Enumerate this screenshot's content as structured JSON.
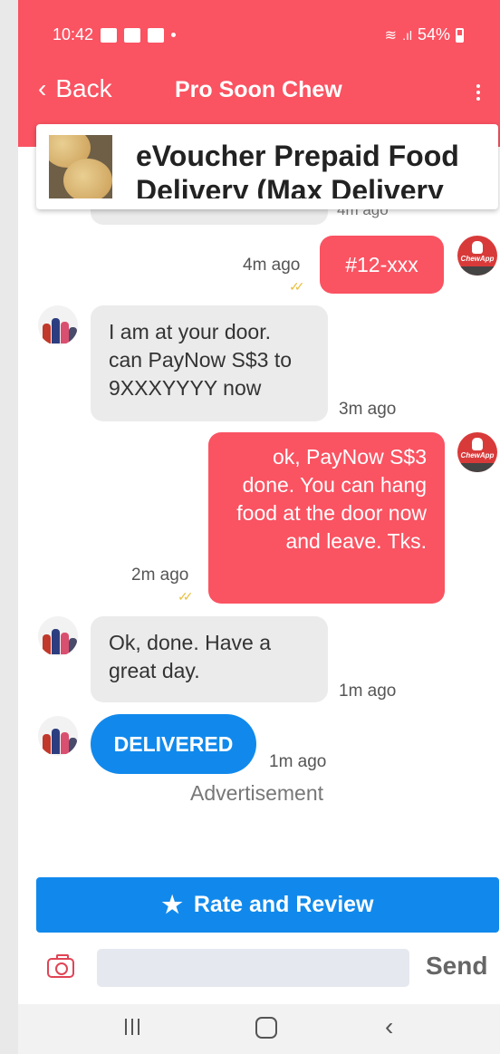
{
  "status": {
    "time": "10:42",
    "battery": "54%"
  },
  "header": {
    "back_label": "Back",
    "title": "Pro Soon Chew",
    "menu_icon": "kebab-menu-icon"
  },
  "product": {
    "name": "eVoucher Prepaid Food Delivery (Max Delivery"
  },
  "messages": [
    {
      "side": "in",
      "time": "4m ago"
    },
    {
      "side": "out",
      "text": "#12-xxx",
      "time": "4m ago"
    },
    {
      "side": "in",
      "text": "I am at your door. can PayNow S$3 to 9XXXYYYY now",
      "time": "3m ago"
    },
    {
      "side": "out",
      "text": "ok, PayNow S$3 done. You can hang food at the door now and leave. Tks.",
      "time": "2m ago"
    },
    {
      "side": "in",
      "text": "Ok, done. Have a great day.",
      "time": "1m ago"
    },
    {
      "side": "in",
      "badge": "DELIVERED",
      "time": "1m ago"
    }
  ],
  "advertisement": "Advertisement",
  "rate_button": "Rate and Review",
  "composer": {
    "placeholder": "",
    "send_label": "Send"
  },
  "avatar_logo": "ChewApp",
  "colors": {
    "brand": "#fa5362",
    "primary_blue": "#1189ec",
    "incoming_bubble": "#ebebeb"
  }
}
